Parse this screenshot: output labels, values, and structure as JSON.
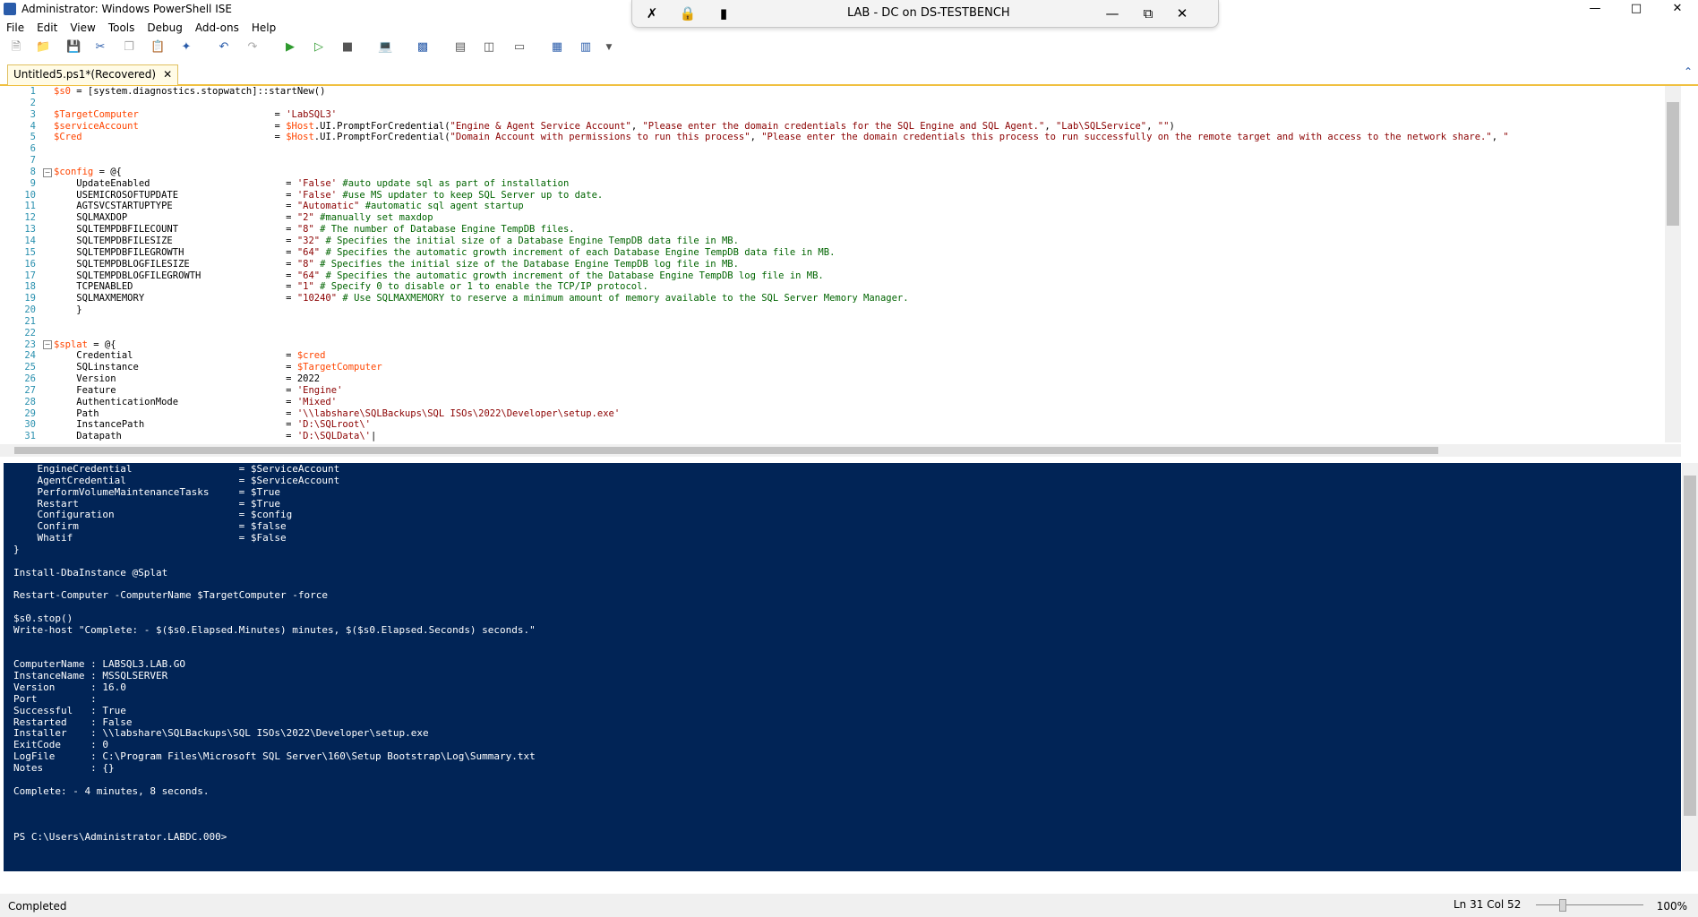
{
  "window": {
    "title": "Administrator: Windows PowerShell ISE"
  },
  "rdp_bar": {
    "title": "LAB - DC on DS-TESTBENCH"
  },
  "menu": [
    "File",
    "Edit",
    "View",
    "Tools",
    "Debug",
    "Add-ons",
    "Help"
  ],
  "tab": {
    "label": "Untitled5.ps1*(Recovered)"
  },
  "editor": {
    "line_numbers": [
      "1",
      "2",
      "3",
      "4",
      "5",
      "6",
      "7",
      "8",
      "9",
      "10",
      "11",
      "12",
      "13",
      "14",
      "15",
      "16",
      "17",
      "18",
      "19",
      "20",
      "21",
      "22",
      "23",
      "24",
      "25",
      "26",
      "27",
      "28",
      "29",
      "30",
      "31"
    ],
    "lines": [
      "$s0 = [system.diagnostics.stopwatch]::startNew()",
      "",
      "$TargetComputer                        = 'LabSQL3'",
      "$serviceAccount                        = $Host.UI.PromptForCredential(\"Engine & Agent Service Account\", \"Please enter the domain credentials for the SQL Engine and SQL Agent.\", \"Lab\\SQLService\", \"\")",
      "$Cred                                  = $Host.UI.PromptForCredential(\"Domain Account with permissions to run this process\", \"Please enter the domain credentials this process to run successfully on the remote target and with access to the network share.\", \"",
      "",
      "",
      "$config = @{",
      "    UpdateEnabled                        = 'False' #auto update sql as part of installation",
      "    USEMICROSOFTUPDATE                   = 'False' #use MS updater to keep SQL Server up to date.",
      "    AGTSVCSTARTUPTYPE                    = \"Automatic\" #automatic sql agent startup",
      "    SQLMAXDOP                            = \"2\" #manually set maxdop",
      "    SQLTEMPDBFILECOUNT                   = \"8\" # The number of Database Engine TempDB files.",
      "    SQLTEMPDBFILESIZE                    = \"32\" # Specifies the initial size of a Database Engine TempDB data file in MB.",
      "    SQLTEMPDBFILEGROWTH                  = \"64\" # Specifies the automatic growth increment of each Database Engine TempDB data file in MB.",
      "    SQLTEMPDBLOGFILESIZE                 = \"8\" # Specifies the initial size of the Database Engine TempDB log file in MB.",
      "    SQLTEMPDBLOGFILEGROWTH               = \"64\" # Specifies the automatic growth increment of the Database Engine TempDB log file in MB.",
      "    TCPENABLED                           = \"1\" # Specify 0 to disable or 1 to enable the TCP/IP protocol.",
      "    SQLMAXMEMORY                         = \"10240\" # Use SQLMAXMEMORY to reserve a minimum amount of memory available to the SQL Server Memory Manager.",
      "    }",
      "",
      "",
      "$splat = @{",
      "    Credential                           = $cred",
      "    SQLinstance                          = $TargetComputer",
      "    Version                              = 2022",
      "    Feature                              = 'Engine'",
      "    AuthenticationMode                   = 'Mixed'",
      "    Path                                 = '\\\\labshare\\SQLBackups\\SQL ISOs\\2022\\Developer\\setup.exe'",
      "    InstancePath                         = 'D:\\SQLroot\\'",
      "    Datapath                             = 'D:\\SQLData\\'|"
    ]
  },
  "console": {
    "lines": [
      "    EngineCredential                  = $ServiceAccount",
      "    AgentCredential                   = $ServiceAccount",
      "    PerformVolumeMaintenanceTasks     = $True",
      "    Restart                           = $True",
      "    Configuration                     = $config",
      "    Confirm                           = $false",
      "    Whatif                            = $False",
      "}",
      "",
      "Install-DbaInstance @Splat",
      "",
      "Restart-Computer -ComputerName $TargetComputer -force",
      "",
      "$s0.stop()",
      "Write-host \"Complete: - $($s0.Elapsed.Minutes) minutes, $($s0.Elapsed.Seconds) seconds.\"",
      "",
      "",
      "ComputerName : LABSQL3.LAB.GO",
      "InstanceName : MSSQLSERVER",
      "Version      : 16.0",
      "Port         :",
      "Successful   : True",
      "Restarted    : False",
      "Installer    : \\\\labshare\\SQLBackups\\SQL ISOs\\2022\\Developer\\setup.exe",
      "ExitCode     : 0",
      "LogFile      : C:\\Program Files\\Microsoft SQL Server\\160\\Setup Bootstrap\\Log\\Summary.txt",
      "Notes        : {}",
      "",
      "Complete: - 4 minutes, 8 seconds.",
      "",
      "",
      "",
      "PS C:\\Users\\Administrator.LABDC.000>"
    ]
  },
  "status": {
    "text": "Completed",
    "position": "Ln 31  Col 52",
    "zoom": "100%"
  },
  "colors": {
    "console_bg": "#012456",
    "variable": "#ff4500",
    "string": "#8b0000",
    "comment": "#006400",
    "line_number": "#2b91af"
  }
}
